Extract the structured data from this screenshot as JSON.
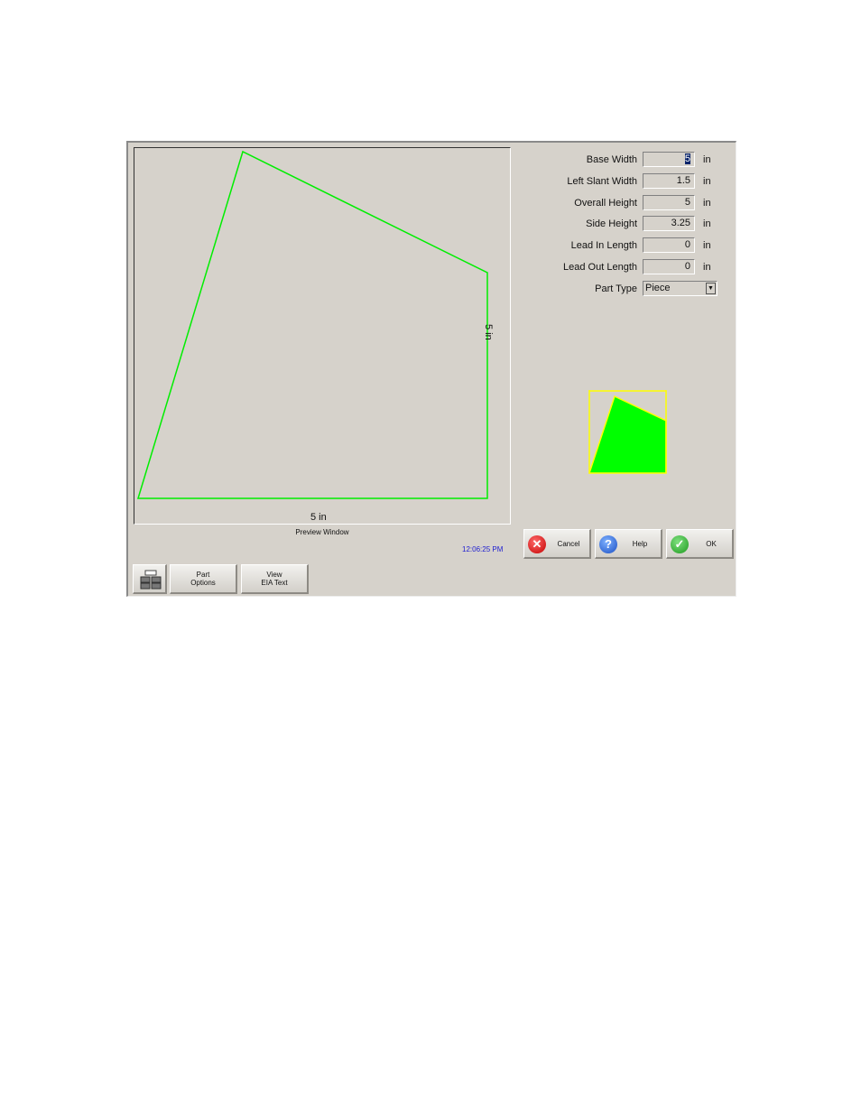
{
  "preview": {
    "label": "Preview Window",
    "base_dimension": "5 in",
    "side_dimension": "5 in",
    "shape_color": "#00ff00"
  },
  "clock": "12:06:25 PM",
  "form": {
    "fields": [
      {
        "label": "Base Width",
        "value": "5",
        "unit": "in",
        "selected": true
      },
      {
        "label": "Left Slant Width",
        "value": "1.5",
        "unit": "in"
      },
      {
        "label": "Overall Height",
        "value": "5",
        "unit": "in"
      },
      {
        "label": "Side Height",
        "value": "3.25",
        "unit": "in"
      },
      {
        "label": "Lead In Length",
        "value": "0",
        "unit": "in"
      },
      {
        "label": "Lead Out Length",
        "value": "0",
        "unit": "in"
      }
    ],
    "part_type": {
      "label": "Part Type",
      "value": "Piece"
    }
  },
  "thumbnail": {
    "fill": "#00ff00",
    "outline": "#ffff00"
  },
  "buttons": {
    "cancel": "Cancel",
    "help": "Help",
    "ok": "OK",
    "keypad_icon": "keypad-icon",
    "part_options_line1": "Part",
    "part_options_line2": "Options",
    "view_eia_line1": "View",
    "view_eia_line2": "EIA Text"
  }
}
